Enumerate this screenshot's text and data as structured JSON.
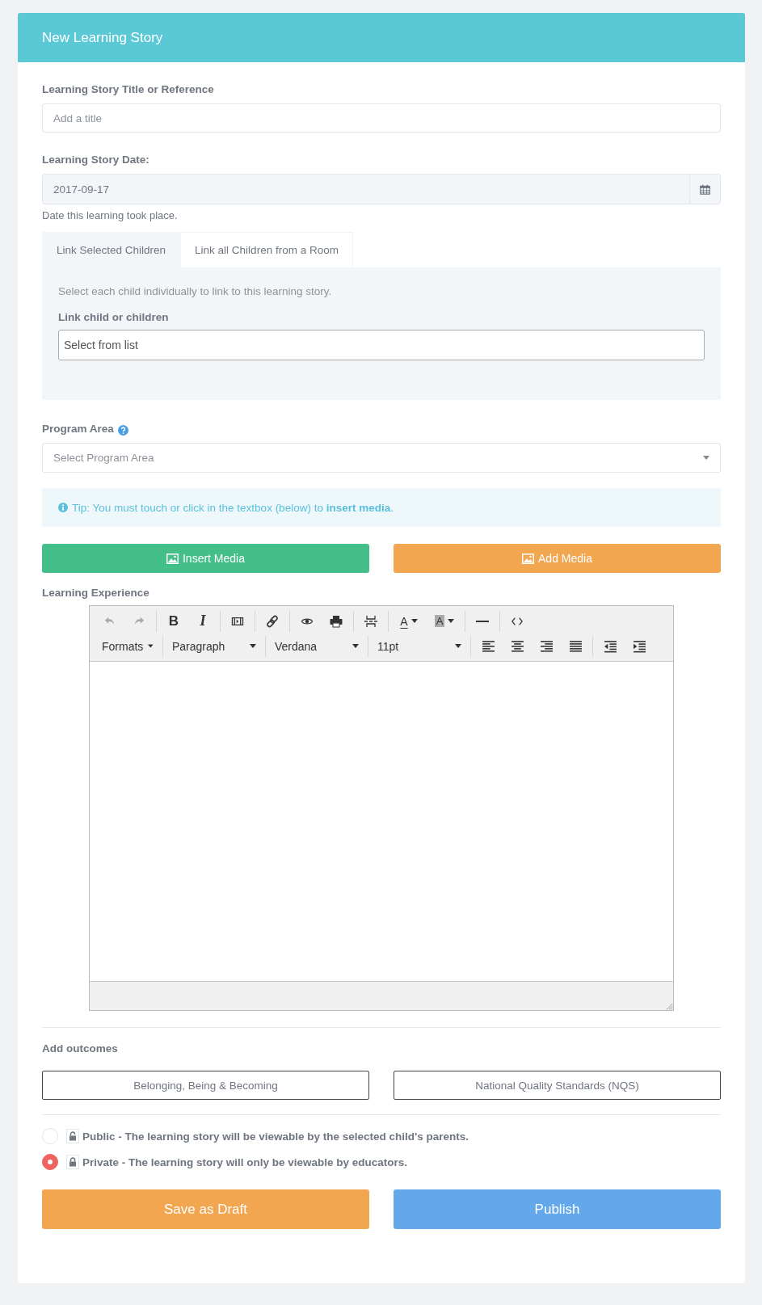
{
  "header": {
    "title": "New Learning Story"
  },
  "title_field": {
    "label": "Learning Story Title or Reference",
    "placeholder": "Add a title"
  },
  "date_field": {
    "label": "Learning Story Date:",
    "value": "2017-09-17",
    "hint": "Date this learning took place."
  },
  "tabs": [
    {
      "label": "Link Selected Children",
      "selected": true
    },
    {
      "label": "Link all Children from a Room",
      "selected": false
    }
  ],
  "tab_panel": {
    "description": "Select each child individually to link to this learning story.",
    "field_label": "Link child or children",
    "placeholder": "Select from list"
  },
  "program_area": {
    "label": "Program Area",
    "placeholder": "Select Program Area"
  },
  "tip": "Tip: You must touch or click in the textbox (below) to **insert media**.",
  "media_buttons": [
    {
      "label": "Insert Media",
      "color": "#45bf89"
    },
    {
      "label": "Add Media",
      "color": "#f2a650"
    }
  ],
  "editor": {
    "label": "Learning Experience",
    "undo_disabled": true,
    "redo_disabled": true,
    "format_buttons": [
      "B",
      "I"
    ],
    "color_buttons": [
      "A",
      "A"
    ],
    "dropdowns": [
      "Formats",
      "Paragraph",
      "Verdana",
      "11pt"
    ]
  },
  "outcomes": {
    "label": "Add outcomes",
    "buttons": [
      "Belonging, Being & Becoming",
      "National Quality Standards (NQS)"
    ]
  },
  "visibility": [
    {
      "label": "Public - The learning story will be viewable by the selected child's parents.",
      "selected": false,
      "locked": false
    },
    {
      "label": "Private - The learning story will only be viewable by educators.",
      "selected": true,
      "locked": true
    }
  ],
  "actions": [
    {
      "label": "Save as Draft",
      "kind": "draft"
    },
    {
      "label": "Publish",
      "kind": "publish"
    }
  ]
}
